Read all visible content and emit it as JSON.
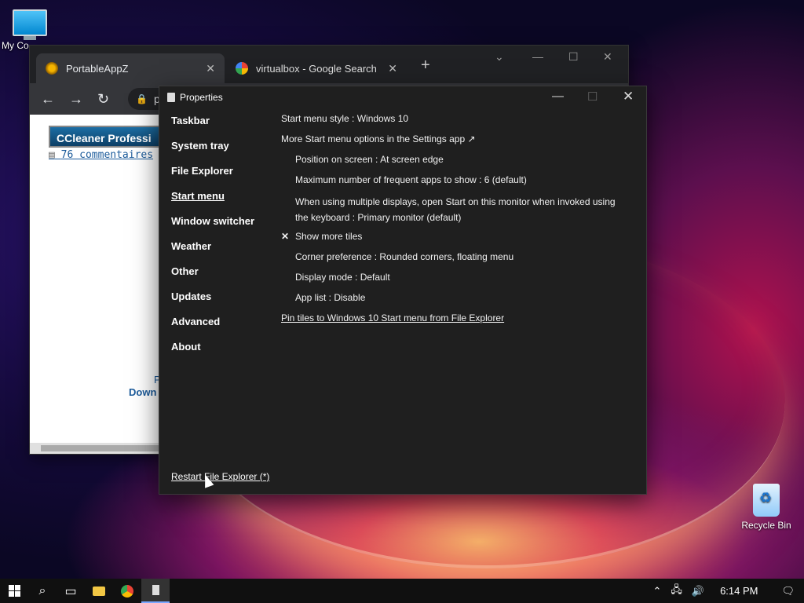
{
  "desktop": {
    "my_computer_label": "My Co",
    "recycle_bin_label": "Recycle Bin"
  },
  "browser": {
    "tabs": [
      {
        "label": "PortableAppZ",
        "active": true
      },
      {
        "label": "virtualbox - Google Search",
        "active": false
      }
    ],
    "address_text": "por",
    "page": {
      "banner_text": "CCleaner Professi",
      "comments_link": "76 commentaires",
      "download_fragment": "Down",
      "small_fragment": "P"
    }
  },
  "properties": {
    "title": "Properties",
    "nav": [
      {
        "label": "Taskbar",
        "active": false
      },
      {
        "label": "System tray",
        "active": false
      },
      {
        "label": "File Explorer",
        "active": false
      },
      {
        "label": "Start menu",
        "active": true
      },
      {
        "label": "Window switcher",
        "active": false
      },
      {
        "label": "Weather",
        "active": false
      },
      {
        "label": "Other",
        "active": false
      },
      {
        "label": "Updates",
        "active": false
      },
      {
        "label": "Advanced",
        "active": false
      },
      {
        "label": "About",
        "active": false
      }
    ],
    "settings": {
      "start_menu_style": "Start menu style : Windows 10",
      "more_options": "More Start menu options in the Settings app ↗",
      "position": "Position on screen : At screen edge",
      "max_frequent": "Maximum number of frequent apps to show : 6 (default)",
      "multi_display": "When using multiple displays, open Start on this monitor when invoked using the keyboard : Primary monitor (default)",
      "show_more_tiles": "Show more tiles",
      "show_more_tiles_checked": true,
      "corner_pref": "Corner preference : Rounded corners, floating menu",
      "display_mode": "Display mode : Default",
      "app_list": "App list : Disable",
      "pin_tiles_link": "Pin tiles to Windows 10 Start menu from File Explorer"
    },
    "restart_link": "Restart File Explorer (*)"
  },
  "taskbar": {
    "clock": "6:14 PM"
  }
}
